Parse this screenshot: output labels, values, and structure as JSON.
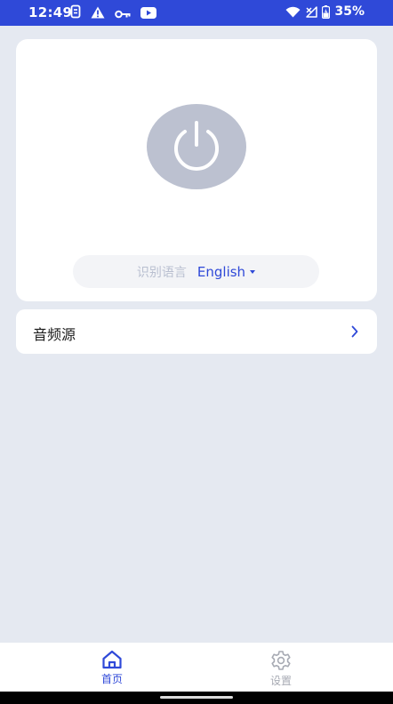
{
  "status_bar": {
    "time": "12:49",
    "left_icons": [
      "sim-icon",
      "warning-icon",
      "key-icon",
      "youtube-icon"
    ],
    "right_icons": [
      "wifi-icon",
      "signal-icon",
      "battery-icon"
    ],
    "battery": "35%"
  },
  "main": {
    "power_icon": "power-icon",
    "language_label": "识别语言",
    "language_value": "English"
  },
  "audio_source": {
    "label": "音频源",
    "chevron": "chevron-right-icon"
  },
  "bottom_nav": {
    "tabs": [
      {
        "label": "首页",
        "icon": "home-icon",
        "active": true
      },
      {
        "label": "设置",
        "icon": "gear-icon",
        "active": false
      }
    ]
  },
  "colors": {
    "accent": "#2f49d8",
    "background": "#e5e9f1",
    "power_button": "#bcc1d0"
  }
}
